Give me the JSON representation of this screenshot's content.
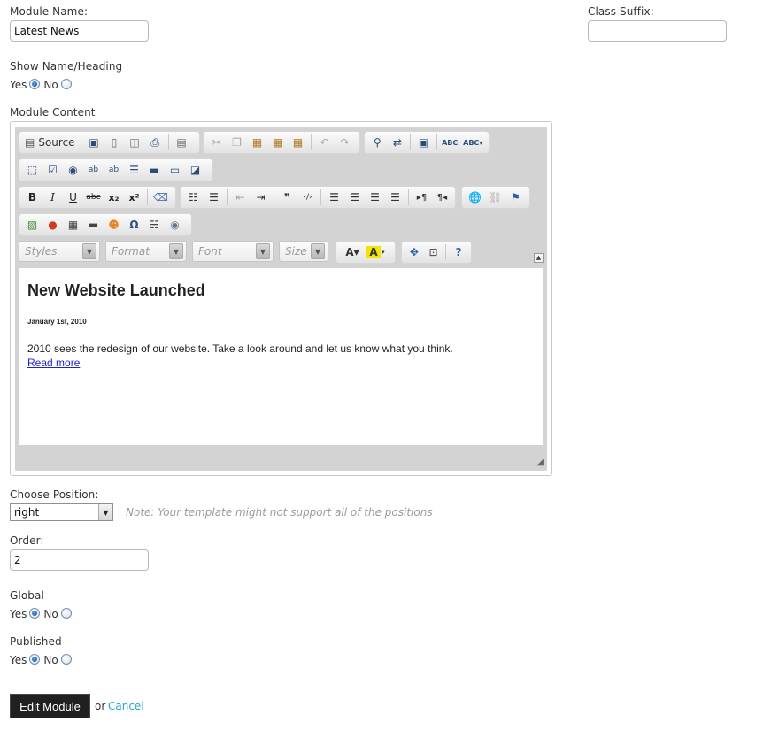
{
  "module_name": {
    "label": "Module Name:",
    "value": "Latest News"
  },
  "class_suffix": {
    "label": "Class Suffix:",
    "value": ""
  },
  "show_name": {
    "label": "Show Name/Heading",
    "yes": "Yes",
    "no": "No",
    "selected": "Yes"
  },
  "module_content": {
    "label": "Module Content",
    "toolbar": {
      "source_label": "Source",
      "combos": {
        "styles": "Styles",
        "format": "Format",
        "font": "Font",
        "size": "Size"
      },
      "icons": [
        "source-icon",
        "save-icon",
        "new-page-icon",
        "preview-icon",
        "print-icon",
        "templates-icon",
        "cut-icon",
        "copy-icon",
        "paste-icon",
        "paste-text-icon",
        "paste-word-icon",
        "undo-icon",
        "redo-icon",
        "find-icon",
        "replace-icon",
        "select-all-icon",
        "spellcheck-icon",
        "scayt-icon",
        "form-icon",
        "checkbox-icon",
        "radio-icon",
        "textfield-icon",
        "textarea-icon",
        "select-field-icon",
        "button-icon",
        "image-button-icon",
        "hidden-field-icon",
        "bold-icon",
        "italic-icon",
        "underline-icon",
        "strike-icon",
        "subscript-icon",
        "superscript-icon",
        "remove-format-icon",
        "numbered-list-icon",
        "bulleted-list-icon",
        "outdent-icon",
        "indent-icon",
        "blockquote-icon",
        "div-icon",
        "align-left-icon",
        "align-center-icon",
        "align-right-icon",
        "justify-icon",
        "ltr-icon",
        "rtl-icon",
        "link-icon",
        "unlink-icon",
        "anchor-icon",
        "image-icon",
        "flash-icon",
        "table-icon",
        "horizontal-rule-icon",
        "smiley-icon",
        "special-char-icon",
        "page-break-icon",
        "iframe-icon",
        "text-color-icon",
        "bg-color-icon",
        "maximize-icon",
        "show-blocks-icon",
        "about-icon"
      ]
    },
    "content": {
      "heading": "New Website Launched",
      "date": "January 1st, 2010",
      "paragraph": "2010 sees the redesign of our website. Take a look around and let us know what you think.",
      "link": "Read more"
    }
  },
  "position": {
    "label": "Choose Position:",
    "value": "right",
    "note": "Note: Your template might not support all of the positions"
  },
  "order": {
    "label": "Order:",
    "value": "2"
  },
  "global": {
    "label": "Global",
    "yes": "Yes",
    "no": "No",
    "selected": "Yes"
  },
  "published": {
    "label": "Published",
    "yes": "Yes",
    "no": "No",
    "selected": "Yes"
  },
  "actions": {
    "submit": "Edit Module",
    "or": "or",
    "cancel": "Cancel"
  }
}
